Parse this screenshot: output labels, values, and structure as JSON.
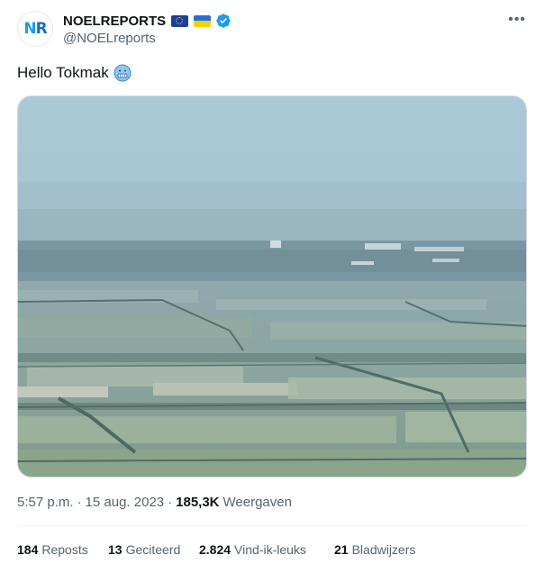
{
  "author": {
    "avatar_text_n": "N",
    "avatar_text_r": "R",
    "display_name": "NOELREPORTS",
    "handle": "@NOELreports",
    "flags": [
      "eu-flag",
      "ukraine-flag"
    ],
    "verified": true
  },
  "tweet": {
    "text": "Hello Tokmak",
    "emoji": "cold-face-emoji"
  },
  "meta": {
    "time": "5:57 p.m.",
    "separator": "·",
    "date": "15 aug. 2023",
    "views_count": "185,3K",
    "views_label": "Weergaven"
  },
  "stats": {
    "reposts_count": "184",
    "reposts_label": "Reposts",
    "quotes_count": "13",
    "quotes_label": "Geciteerd",
    "likes_count": "2.824",
    "likes_label": "Vind-ik-leuks",
    "bookmarks_count": "21",
    "bookmarks_label": "Bladwijzers"
  },
  "more_glyph": "•••",
  "colors": {
    "accent": "#1d9bf0",
    "text_primary": "#0f1419",
    "text_secondary": "#536471"
  }
}
